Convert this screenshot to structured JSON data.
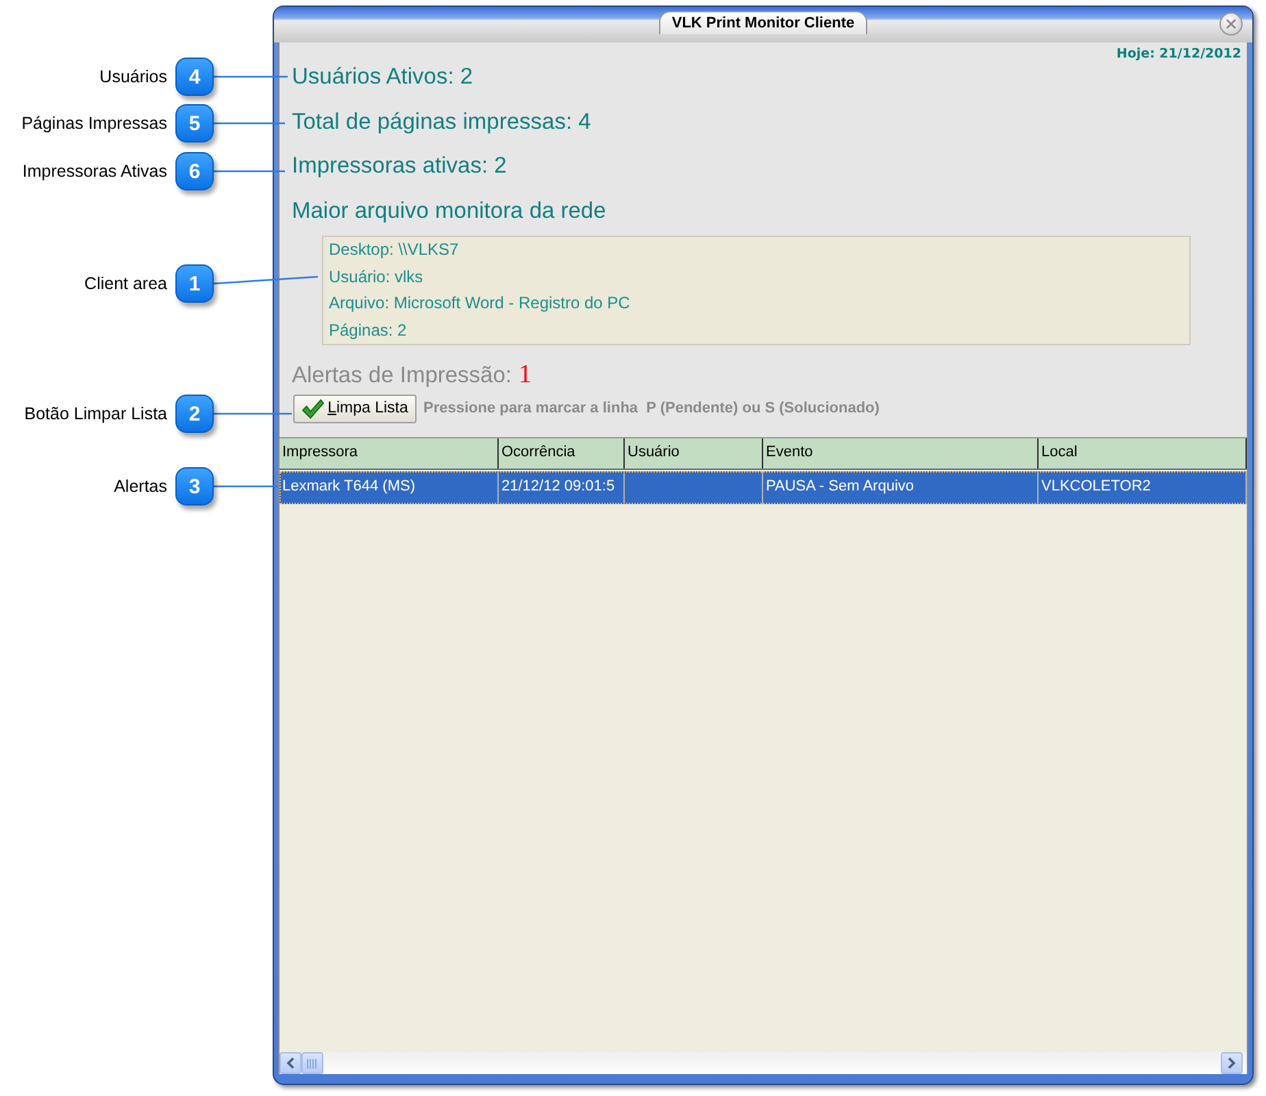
{
  "callouts": [
    {
      "number": "4",
      "label": "Usuários"
    },
    {
      "number": "5",
      "label": "Páginas Impressas"
    },
    {
      "number": "6",
      "label": "Impressoras Ativas"
    },
    {
      "number": "1",
      "label": "Client area"
    },
    {
      "number": "2",
      "label": "Botão Limpar Lista"
    },
    {
      "number": "3",
      "label": "Alertas"
    }
  ],
  "window": {
    "title": "VLK Print Monitor Cliente"
  },
  "date": "Hoje: 21/12/2012",
  "stats": [
    "Usuários Ativos: 2",
    "Total de páginas impressas: 4",
    "Impressoras ativas: 2"
  ],
  "largest_file": {
    "heading": "Maior arquivo monitora da rede",
    "lines": [
      "Desktop: \\\\VLKS7",
      "Usuário: vlks",
      "Arquivo: Microsoft Word - Registro do PC",
      "Páginas: 2"
    ]
  },
  "alerts": {
    "label": "Alertas de Impressão:",
    "count": "1"
  },
  "clear_button": {
    "label": "Limpa Lista"
  },
  "hint": "Pressione para marcar a linha  P (Pendente) ou S (Solucionado)",
  "table": {
    "columns": [
      "Impressora",
      "Ocorrência",
      "Usuário",
      "Evento",
      "Local"
    ],
    "rows": [
      {
        "selected": true,
        "printer": "Lexmark T644 (MS)",
        "occurrence": "21/12/12 09:01:5",
        "event": "PAUSA - Sem Arquivo",
        "location": "VLKCOLETOR2"
      }
    ]
  }
}
